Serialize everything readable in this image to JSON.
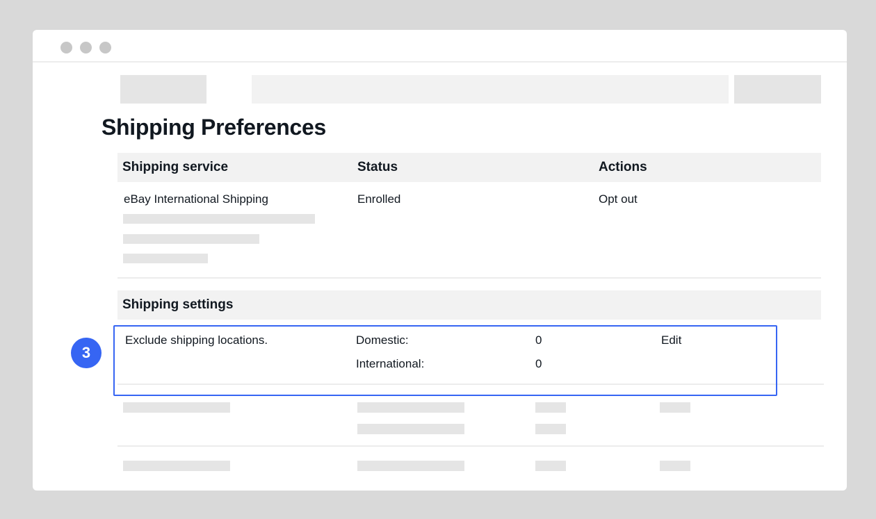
{
  "page": {
    "title": "Shipping Preferences"
  },
  "service_table": {
    "headers": [
      "Shipping service",
      "Status",
      "Actions"
    ],
    "row": {
      "service": "eBay International Shipping",
      "status": "Enrolled",
      "action": "Opt out"
    }
  },
  "settings": {
    "header": "Shipping settings",
    "exclude_label": "Exclude shipping locations.",
    "domestic_label": "Domestic:",
    "domestic_value": "0",
    "international_label": "International:",
    "international_value": "0",
    "edit_label": "Edit"
  },
  "step_badge": "3",
  "colors": {
    "accent": "#3665f3",
    "background": "#d9d9d9",
    "header_bg": "#f2f2f2",
    "placeholder": "#e5e5e5"
  }
}
